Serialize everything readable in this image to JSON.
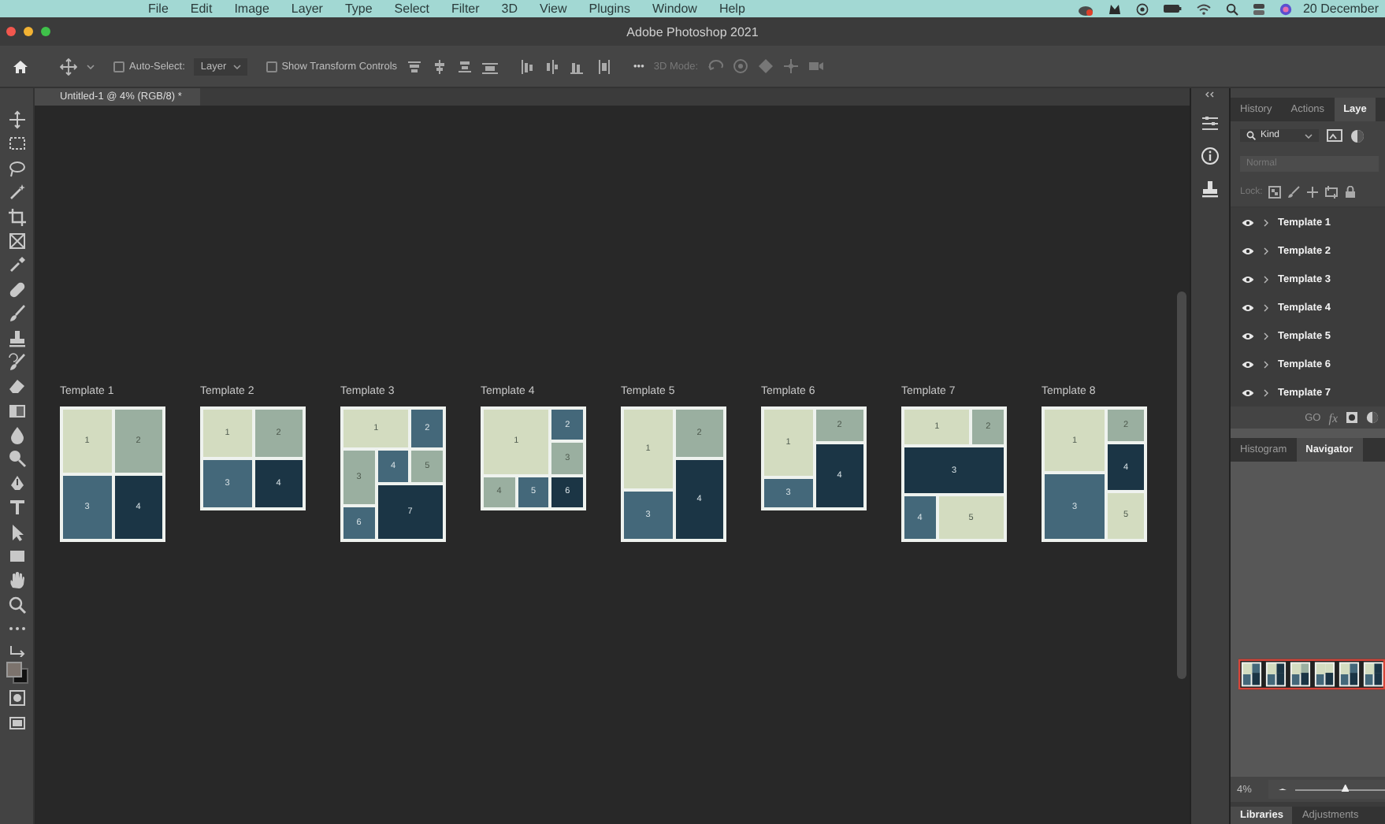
{
  "menu_bar": {
    "items": [
      "File",
      "Edit",
      "Image",
      "Layer",
      "Type",
      "Select",
      "Filter",
      "3D",
      "View",
      "Plugins",
      "Window",
      "Help"
    ],
    "clock": "20 December"
  },
  "window": {
    "title": "Adobe Photoshop 2021"
  },
  "options_bar": {
    "auto_select": {
      "label": "Auto-Select:",
      "checked": false
    },
    "target": "Layer",
    "transform_controls": {
      "label": "Show Transform Controls",
      "checked": false
    },
    "more": "•••",
    "mode_label": "3D Mode:"
  },
  "document_tab": {
    "title": "Untitled-1 @ 4% (RGB/8) *"
  },
  "templates": [
    {
      "title": "Template 1",
      "tiles": [
        {
          "label": "1",
          "color": "#d3dcc0"
        },
        {
          "label": "2",
          "color": "#9aafa0"
        },
        {
          "label": "3",
          "color": "#44687a"
        },
        {
          "label": "4",
          "color": "#1b3545"
        }
      ]
    },
    {
      "title": "Template 2",
      "tiles": [
        {
          "label": "1",
          "color": "#d3dcc0"
        },
        {
          "label": "2",
          "color": "#9aafa0"
        },
        {
          "label": "3",
          "color": "#44687a"
        },
        {
          "label": "4",
          "color": "#1b3545"
        }
      ]
    },
    {
      "title": "Template 3",
      "tiles": [
        {
          "label": "1",
          "color": "#d3dcc0"
        },
        {
          "label": "2",
          "color": "#44687a"
        },
        {
          "label": "3",
          "color": "#9aafa0"
        },
        {
          "label": "4",
          "color": "#44687a"
        },
        {
          "label": "5",
          "color": "#9aafa0"
        },
        {
          "label": "6",
          "color": "#44687a"
        },
        {
          "label": "7",
          "color": "#1b3545"
        }
      ]
    },
    {
      "title": "Template 4",
      "tiles": [
        {
          "label": "1",
          "color": "#d3dcc0"
        },
        {
          "label": "2",
          "color": "#44687a"
        },
        {
          "label": "3",
          "color": "#9aafa0"
        },
        {
          "label": "4",
          "color": "#9aafa0"
        },
        {
          "label": "5",
          "color": "#44687a"
        },
        {
          "label": "6",
          "color": "#1b3545"
        }
      ]
    },
    {
      "title": "Template 5",
      "tiles": [
        {
          "label": "1",
          "color": "#d3dcc0"
        },
        {
          "label": "2",
          "color": "#9aafa0"
        },
        {
          "label": "4",
          "color": "#1b3545"
        },
        {
          "label": "3",
          "color": "#44687a"
        }
      ]
    },
    {
      "title": "Template 6",
      "tiles": [
        {
          "label": "1",
          "color": "#d3dcc0"
        },
        {
          "label": "2",
          "color": "#9aafa0"
        },
        {
          "label": "4",
          "color": "#1b3545"
        },
        {
          "label": "3",
          "color": "#44687a"
        }
      ]
    },
    {
      "title": "Template 7",
      "tiles": [
        {
          "label": "1",
          "color": "#d3dcc0"
        },
        {
          "label": "2",
          "color": "#9aafa0"
        },
        {
          "label": "3",
          "color": "#1b3545"
        },
        {
          "label": "4",
          "color": "#44687a"
        },
        {
          "label": "5",
          "color": "#d3dcc0"
        }
      ]
    },
    {
      "title": "Template 8",
      "tiles": [
        {
          "label": "1",
          "color": "#d3dcc0"
        },
        {
          "label": "2",
          "color": "#9aafa0"
        },
        {
          "label": "4",
          "color": "#1b3545"
        },
        {
          "label": "3",
          "color": "#44687a"
        },
        {
          "label": "5",
          "color": "#d3dcc0"
        }
      ]
    }
  ],
  "layers_panel": {
    "tabs": [
      {
        "label": "History",
        "selected": false
      },
      {
        "label": "Actions",
        "selected": false
      },
      {
        "label": "Laye",
        "selected": true
      }
    ],
    "filter": "Kind",
    "blend_mode": "Normal",
    "lock_label": "Lock:",
    "layers": [
      {
        "name": "Template 1",
        "visible": true
      },
      {
        "name": "Template 2",
        "visible": true
      },
      {
        "name": "Template 3",
        "visible": true
      },
      {
        "name": "Template 4",
        "visible": true
      },
      {
        "name": "Template 5",
        "visible": true
      },
      {
        "name": "Template 6",
        "visible": true
      },
      {
        "name": "Template 7",
        "visible": true
      }
    ],
    "footer_link": "GO",
    "footer_fx": "fx"
  },
  "navigator_panel": {
    "tabs": [
      {
        "label": "Histogram",
        "selected": false
      },
      {
        "label": "Navigator",
        "selected": true
      }
    ],
    "zoom": "4%",
    "level": 0.55
  },
  "bottom_tabs": [
    {
      "label": "Libraries",
      "selected": true
    },
    {
      "label": "Adjustments",
      "selected": false
    }
  ]
}
